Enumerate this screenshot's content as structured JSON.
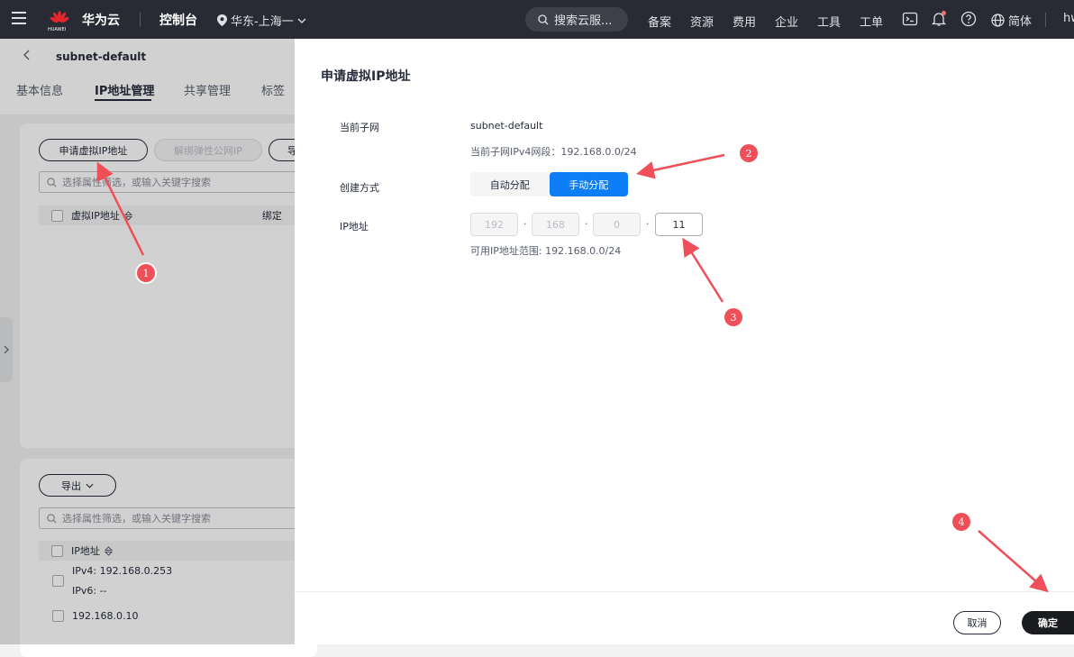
{
  "topbar": {
    "logo_text": "HUAWEI",
    "brand": "华为云",
    "console": "控制台",
    "region": "华东-上海一",
    "search_placeholder": "搜索云服...",
    "nav": [
      "备案",
      "资源",
      "费用",
      "企业",
      "工具",
      "工单"
    ],
    "language": "简体",
    "user": "hw"
  },
  "background": {
    "subnet_title": "subnet-default",
    "tabs": [
      "基本信息",
      "IP地址管理",
      "共享管理",
      "标签"
    ],
    "active_tab": "IP地址管理",
    "virtual_ip": {
      "apply_button": "申请虚拟IP地址",
      "unbind_button": "解绑弹性公网IP",
      "more_button": "导",
      "filter_placeholder": "选择属性筛选，或输入关键字搜索",
      "col_virtual_ip": "虚拟IP地址",
      "col_bind": "绑定"
    },
    "ip_list": {
      "export_button": "导出",
      "filter_placeholder": "选择属性筛选，或输入关键字搜索",
      "col_ip": "IP地址",
      "row1_ipv4": "IPv4: 192.168.0.253",
      "row1_ipv6": "IPv6: --",
      "row2_ipv4": "192.168.0.10"
    }
  },
  "drawer": {
    "title": "申请虚拟IP地址",
    "current_subnet_label": "当前子网",
    "current_subnet_value": "subnet-default",
    "current_subnet_hint": "当前子网IPv4网段：192.168.0.0/24",
    "create_mode_label": "创建方式",
    "mode_auto": "自动分配",
    "mode_manual": "手动分配",
    "active_mode": "手动分配",
    "ip_label": "IP地址",
    "ip_octets": [
      "192",
      "168",
      "0",
      "11"
    ],
    "ip_range_hint": "可用IP地址范围: 192.168.0.0/24",
    "cancel_button": "取消",
    "ok_button": "确定"
  },
  "annotations": {
    "markers": [
      "1",
      "2",
      "3",
      "4"
    ],
    "color": "#ef4f58"
  },
  "colors": {
    "topbar_bg": "#282b33",
    "primary_blue": "#0d7ef5",
    "ok_button_bg": "#1b1c1f"
  }
}
